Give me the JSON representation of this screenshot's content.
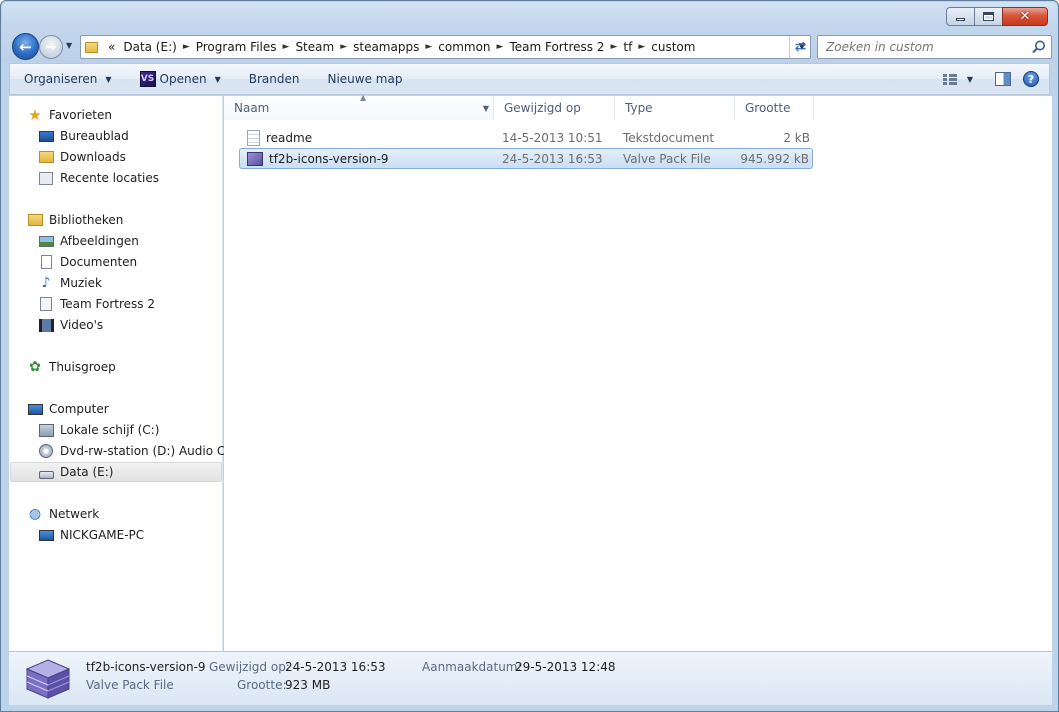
{
  "window": {
    "caption_min": "_",
    "caption_max": "□",
    "caption_close": "x"
  },
  "address_bar": {
    "overflow": "«",
    "crumbs": [
      "Data (E:)",
      "Program Files",
      "Steam",
      "steamapps",
      "common",
      "Team Fortress 2",
      "tf",
      "custom"
    ]
  },
  "search": {
    "placeholder": "Zoeken in custom"
  },
  "toolbar": {
    "organize": "Organiseren",
    "open": "Openen",
    "burn": "Branden",
    "new_folder": "Nieuwe map"
  },
  "nav": {
    "favorites": {
      "label": "Favorieten",
      "items": [
        "Bureaublad",
        "Downloads",
        "Recente locaties"
      ]
    },
    "libraries": {
      "label": "Bibliotheken",
      "items": [
        "Afbeeldingen",
        "Documenten",
        "Muziek",
        "Team Fortress 2",
        "Video's"
      ]
    },
    "homegroup": {
      "label": "Thuisgroep"
    },
    "computer": {
      "label": "Computer",
      "items": [
        "Lokale schijf (C:)",
        "Dvd-rw-station (D:) Audio CD",
        "Data (E:)"
      ],
      "selected_index": 2
    },
    "network": {
      "label": "Netwerk",
      "items": [
        "NICKGAME-PC"
      ]
    }
  },
  "columns": {
    "name": "Naam",
    "modified": "Gewijzigd op",
    "type": "Type",
    "size": "Grootte"
  },
  "files": [
    {
      "name": "readme",
      "modified": "14-5-2013 10:51",
      "type": "Tekstdocument",
      "size": "2 kB",
      "icon": "text-document-icon",
      "selected": false
    },
    {
      "name": "tf2b-icons-version-9",
      "modified": "24-5-2013 16:53",
      "type": "Valve Pack File",
      "size": "945.992 kB",
      "icon": "vpk-file-icon",
      "selected": true
    }
  ],
  "details": {
    "name": "tf2b-icons-version-9",
    "type": "Valve Pack File",
    "modified_label": "Gewijzigd op:",
    "modified_value": "24-5-2013 16:53",
    "size_label": "Grootte:",
    "size_value": "923 MB",
    "created_label": "Aanmaakdatum:",
    "created_value": "29-5-2013 12:48"
  },
  "colors": {
    "accent": "#1e395b",
    "selection_border": "#84acdd",
    "frame": "#bcd3ea"
  }
}
